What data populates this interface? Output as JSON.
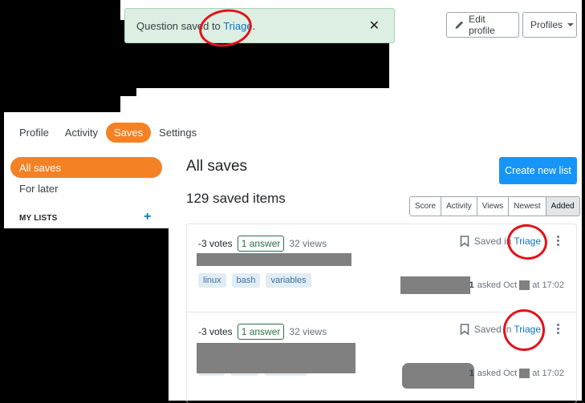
{
  "toast": {
    "message_prefix": "Question saved to",
    "list_link": "Triage",
    "suffix": ".",
    "close_label": "✕"
  },
  "header": {
    "edit_profile_label": "Edit profile",
    "profiles_label": "Profiles"
  },
  "tabs": [
    {
      "label": "Profile",
      "active": false
    },
    {
      "label": "Activity",
      "active": false
    },
    {
      "label": "Saves",
      "active": true
    },
    {
      "label": "Settings",
      "active": false
    }
  ],
  "sidebar": {
    "items": [
      {
        "label": "All saves",
        "active": true
      },
      {
        "label": "For later",
        "active": false
      }
    ],
    "my_lists_label": "MY LISTS",
    "add_list_icon": "+"
  },
  "main": {
    "title": "All saves",
    "count_label": "129 saved items",
    "create_button": "Create new list",
    "sort_options": [
      {
        "label": "Score",
        "active": false
      },
      {
        "label": "Activity",
        "active": false
      },
      {
        "label": "Views",
        "active": false
      },
      {
        "label": "Newest",
        "active": false
      },
      {
        "label": "Added",
        "active": true
      }
    ]
  },
  "questions": [
    {
      "votes": "-3 votes",
      "answers": "1 answer",
      "views": "32 views",
      "saved_prefix": "Saved in",
      "saved_list": "Triage",
      "tags": [
        "linux",
        "bash",
        "variables"
      ],
      "reputation": "1",
      "asked_prefix": "asked Oct",
      "asked_time": "at 17:02"
    },
    {
      "votes": "-3 votes",
      "answers": "1 answer",
      "views": "32 views",
      "saved_prefix": "Saved in",
      "saved_list": "Triage",
      "tags": [
        "",
        "",
        ""
      ],
      "reputation": "1",
      "asked_prefix": "asked Oct",
      "asked_time": "at 17:02"
    }
  ],
  "colors": {
    "accent_orange": "#f48225",
    "primary_blue": "#1595f8",
    "link_blue": "#0a74c4",
    "toast_bg": "#dcefe2",
    "annotation_red": "#e3121a"
  }
}
